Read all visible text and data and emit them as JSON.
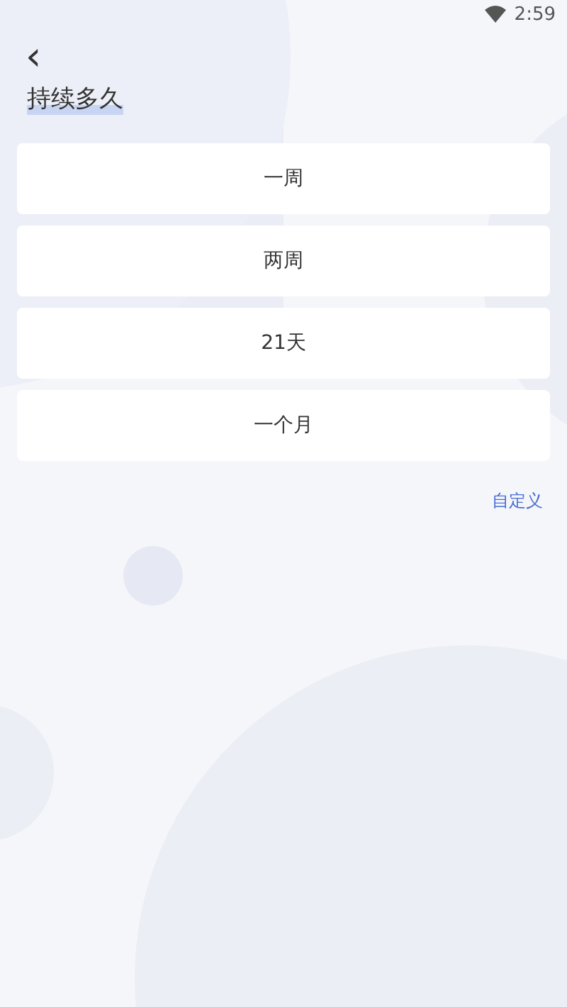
{
  "status_bar": {
    "time": "2:59"
  },
  "header": {
    "back": "‹",
    "title": "持续多久"
  },
  "options": [
    {
      "label": "一周"
    },
    {
      "label": "两周"
    },
    {
      "label": "21天"
    },
    {
      "label": "一个月"
    }
  ],
  "custom_link": "自定义"
}
